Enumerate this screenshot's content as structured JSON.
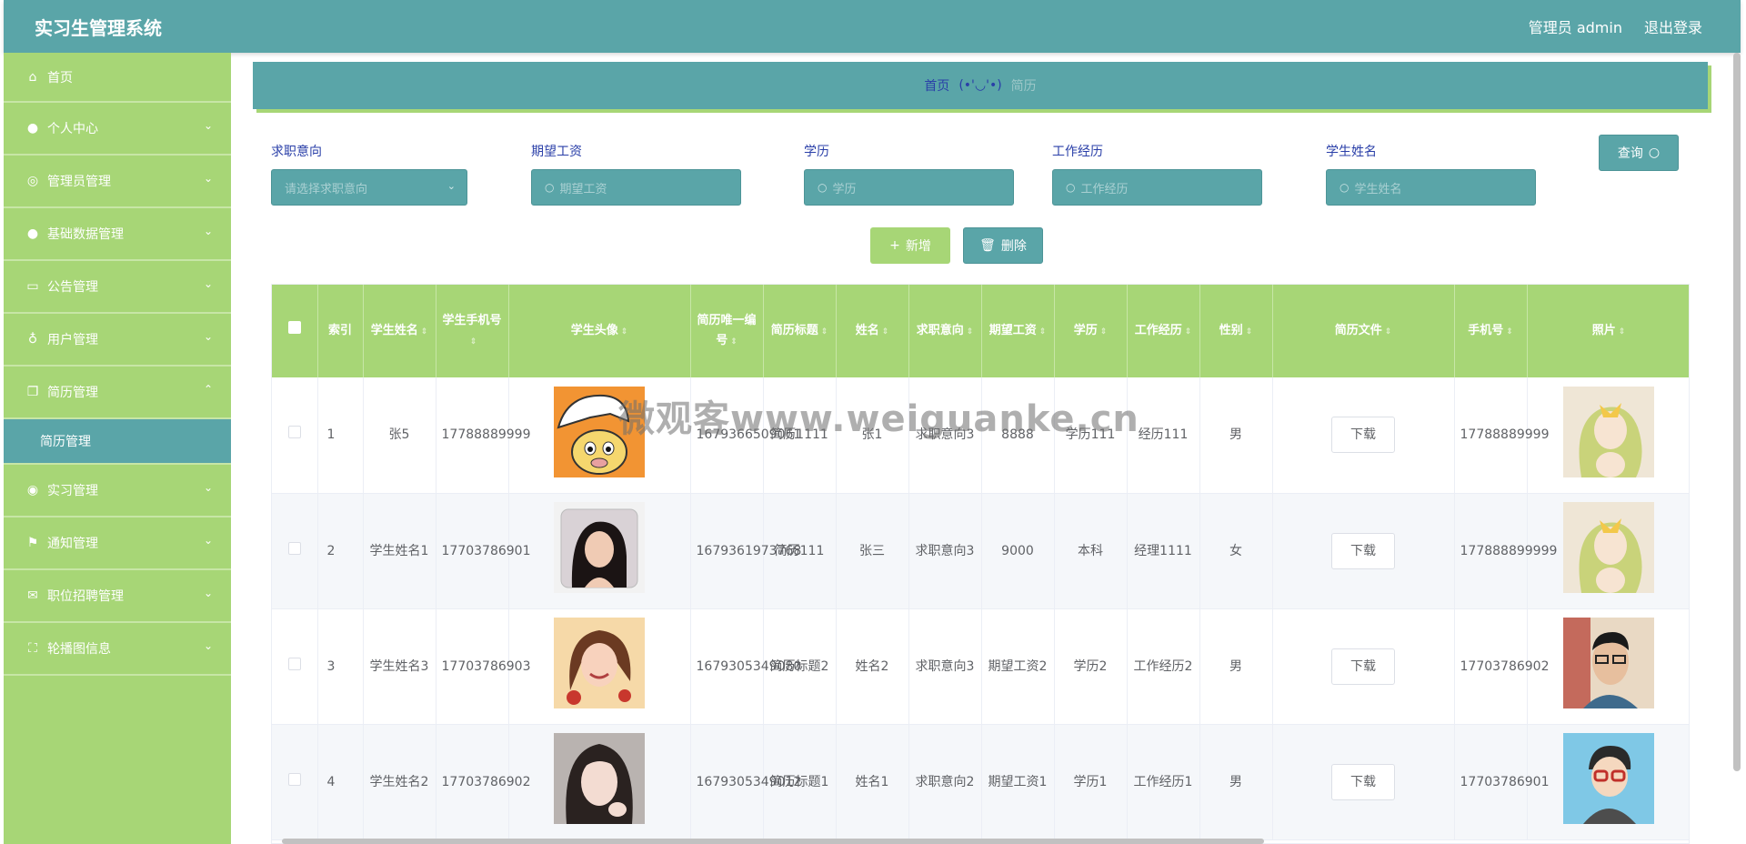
{
  "header": {
    "title": "实习生管理系统",
    "user": "管理员 admin",
    "logout": "退出登录"
  },
  "sidebar": {
    "items": [
      {
        "label": "首页",
        "icon": "home-icon"
      },
      {
        "label": "个人中心",
        "icon": "user-icon"
      },
      {
        "label": "管理员管理",
        "icon": "compass-icon"
      },
      {
        "label": "基础数据管理",
        "icon": "user-icon"
      },
      {
        "label": "公告管理",
        "icon": "chat-icon"
      },
      {
        "label": "用户管理",
        "icon": "mic-icon"
      },
      {
        "label": "简历管理",
        "icon": "copy-icon",
        "expanded": true
      },
      {
        "label": "实习管理",
        "icon": "ring-icon"
      },
      {
        "label": "通知管理",
        "icon": "flag-icon"
      },
      {
        "label": "职位招聘管理",
        "icon": "mail-icon"
      },
      {
        "label": "轮播图信息",
        "icon": "fullscreen-icon"
      }
    ],
    "submenu": {
      "label": "简历管理"
    }
  },
  "breadcrumb": {
    "home": "首页",
    "separator": "(•'◡'•)",
    "current": "简历"
  },
  "filters": {
    "intent": {
      "label": "求职意向",
      "placeholder": "请选择求职意向"
    },
    "salary": {
      "label": "期望工资",
      "placeholder": "期望工资"
    },
    "education": {
      "label": "学历",
      "placeholder": "学历"
    },
    "experience": {
      "label": "工作经历",
      "placeholder": "工作经历"
    },
    "student_name": {
      "label": "学生姓名",
      "placeholder": "学生姓名"
    },
    "query": "查询"
  },
  "actions": {
    "add": "新增",
    "delete": "删除"
  },
  "table": {
    "headers": {
      "index": "索引",
      "student_name": "学生姓名",
      "student_phone": "学生手机号",
      "student_avatar": "学生头像",
      "resume_id": "简历唯一编号",
      "resume_title": "简历标题",
      "name": "姓名",
      "intent": "求职意向",
      "salary": "期望工资",
      "education": "学历",
      "experience": "工作经历",
      "gender": "性别",
      "resume_file": "简历文件",
      "phone": "手机号",
      "photo": "照片"
    },
    "rows": [
      {
        "index": "1",
        "student_name": "张5",
        "student_phone": "17788889999",
        "resume_id": "1679366509061",
        "resume_title": "简历1111",
        "name": "张1",
        "intent": "求职意向3",
        "salary": "8888",
        "education": "学历111",
        "experience": "经历111",
        "gender": "男",
        "download": "下载",
        "phone": "17788889999"
      },
      {
        "index": "2",
        "student_name": "学生姓名1",
        "student_phone": "17703786901",
        "resume_id": "1679361973768",
        "resume_title": "简历111",
        "name": "张三",
        "intent": "求职意向3",
        "salary": "9000",
        "education": "本科",
        "experience": "经理1111",
        "gender": "女",
        "download": "下载",
        "phone": "177888899999"
      },
      {
        "index": "3",
        "student_name": "学生姓名3",
        "student_phone": "17703786903",
        "resume_id": "1679305349080",
        "resume_title": "简历标题2",
        "name": "姓名2",
        "intent": "求职意向3",
        "salary": "期望工资2",
        "education": "学历2",
        "experience": "工作经历2",
        "gender": "男",
        "download": "下载",
        "phone": "17703786902"
      },
      {
        "index": "4",
        "student_name": "学生姓名2",
        "student_phone": "17703786902",
        "resume_id": "1679305349012",
        "resume_title": "简历标题1",
        "name": "姓名1",
        "intent": "求职意向2",
        "salary": "期望工资1",
        "education": "学历1",
        "experience": "工作经历1",
        "gender": "男",
        "download": "下载",
        "phone": "17703786901"
      }
    ]
  },
  "watermark": "微观客www.weiguanke.cn",
  "colors": {
    "primary": "#5aa5a8",
    "accent": "#a7d676",
    "link": "#2a3fa8"
  }
}
